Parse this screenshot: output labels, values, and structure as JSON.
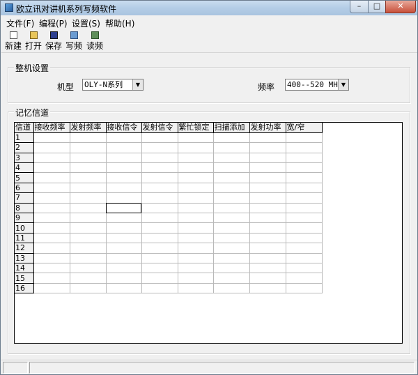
{
  "window": {
    "title": "欧立讯对讲机系列写频软件",
    "buttons": {
      "minimize": "–",
      "maximize": "□",
      "close": "✕"
    }
  },
  "menu": [
    "文件(F)",
    "编程(P)",
    "设置(S)",
    "帮助(H)"
  ],
  "toolbar": [
    {
      "label": "新建",
      "icon": "new-file-icon"
    },
    {
      "label": "打开",
      "icon": "open-folder-icon"
    },
    {
      "label": "保存",
      "icon": "save-disk-icon"
    },
    {
      "label": "写频",
      "icon": "write-radio-icon"
    },
    {
      "label": "读频",
      "icon": "read-radio-icon"
    }
  ],
  "settings": {
    "group_title": "整机设置",
    "model_label": "机型",
    "model_value": "OLY-N系列",
    "freq_label": "频率",
    "freq_value": "400--520 MHz"
  },
  "memory": {
    "group_title": "记忆信道",
    "columns": [
      "信道",
      "接收频率",
      "发射频率",
      "接收信令",
      "发射信令",
      "繁忙锁定",
      "扫描添加",
      "发射功率",
      "宽/窄"
    ],
    "rows": [
      "1",
      "2",
      "3",
      "4",
      "5",
      "6",
      "7",
      "8",
      "9",
      "10",
      "11",
      "12",
      "13",
      "14",
      "15",
      "16"
    ],
    "selected_row": "8",
    "selected_column": "接收信令"
  },
  "colors": {
    "window_bg": "#f0f0f0",
    "title_gradient_top": "#c9dcef",
    "close_button": "#c7503a"
  }
}
